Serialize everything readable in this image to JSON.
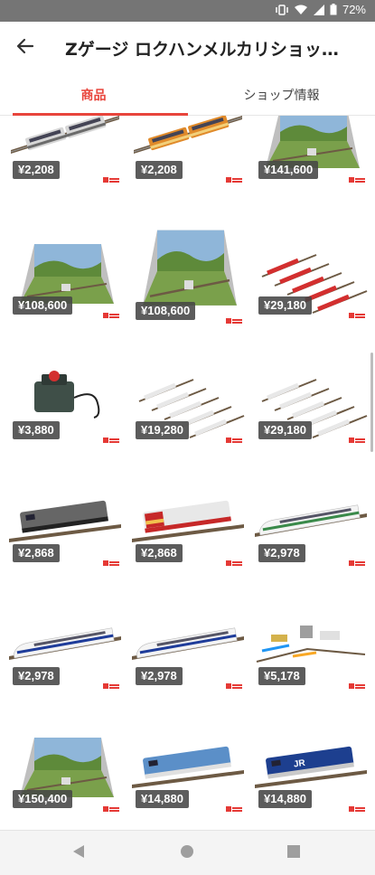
{
  "status_bar": {
    "battery_text": "72%"
  },
  "header": {
    "title": "Zゲージ ロクハンメルカリショッ…"
  },
  "tabs": [
    {
      "label": "商品",
      "selected": true
    },
    {
      "label": "ショップ情報",
      "selected": false
    }
  ],
  "accent_color": "#e8453c",
  "products": [
    {
      "price": "¥2,208",
      "kind": "train-grey"
    },
    {
      "price": "¥2,208",
      "kind": "train-orange"
    },
    {
      "price": "¥141,600",
      "kind": "diorama"
    },
    {
      "price": "¥108,600",
      "kind": "diorama"
    },
    {
      "price": "¥108,600",
      "kind": "diorama"
    },
    {
      "price": "¥29,180",
      "kind": "track-set-red"
    },
    {
      "price": "¥3,880",
      "kind": "controller"
    },
    {
      "price": "¥19,280",
      "kind": "track-set-white"
    },
    {
      "price": "¥29,180",
      "kind": "track-set-white"
    },
    {
      "price": "¥2,868",
      "kind": "loco-grey"
    },
    {
      "price": "¥2,868",
      "kind": "loco-santafe"
    },
    {
      "price": "¥2,978",
      "kind": "train-shinkansen-grey"
    },
    {
      "price": "¥2,978",
      "kind": "train-shinkansen"
    },
    {
      "price": "¥2,978",
      "kind": "train-shinkansen"
    },
    {
      "price": "¥5,178",
      "kind": "layout-parts"
    },
    {
      "price": "¥150,400",
      "kind": "diorama"
    },
    {
      "price": "¥14,880",
      "kind": "loco-blue-white"
    },
    {
      "price": "¥14,880",
      "kind": "loco-jr-blue"
    }
  ],
  "nav": [
    "back-triangle-icon",
    "home-circle-icon",
    "recents-square-icon"
  ]
}
